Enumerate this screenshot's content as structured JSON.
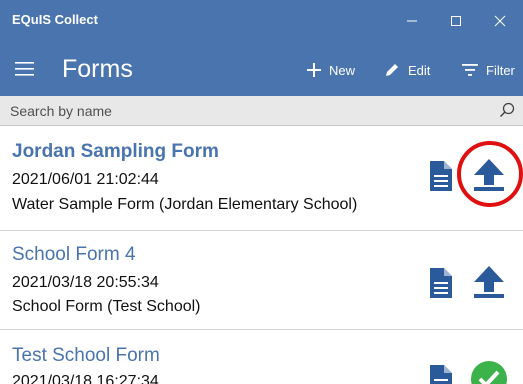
{
  "window": {
    "app_title": "EQuIS Collect"
  },
  "header": {
    "title": "Forms",
    "new_label": "New",
    "edit_label": "Edit",
    "filter_label": "Filter"
  },
  "search": {
    "placeholder": "Search by name"
  },
  "forms": [
    {
      "name": "Jordan Sampling Form",
      "timestamp": "2021/06/01 21:02:44",
      "description": "Water Sample Form (Jordan Elementary School)",
      "status_icon": "upload-icon",
      "highlighted": true
    },
    {
      "name": "School Form 4",
      "timestamp": "2021/03/18 20:55:34",
      "description": "School Form (Test School)",
      "status_icon": "upload-icon",
      "highlighted": false
    },
    {
      "name": "Test School Form",
      "timestamp": "2021/03/18 16:27:34",
      "status_icon": "check-icon",
      "highlighted": false
    }
  ],
  "colors": {
    "brand": "#4a74ad",
    "icon": "#2a5a9a",
    "success": "#3cb34a",
    "highlight": "#e01010"
  }
}
